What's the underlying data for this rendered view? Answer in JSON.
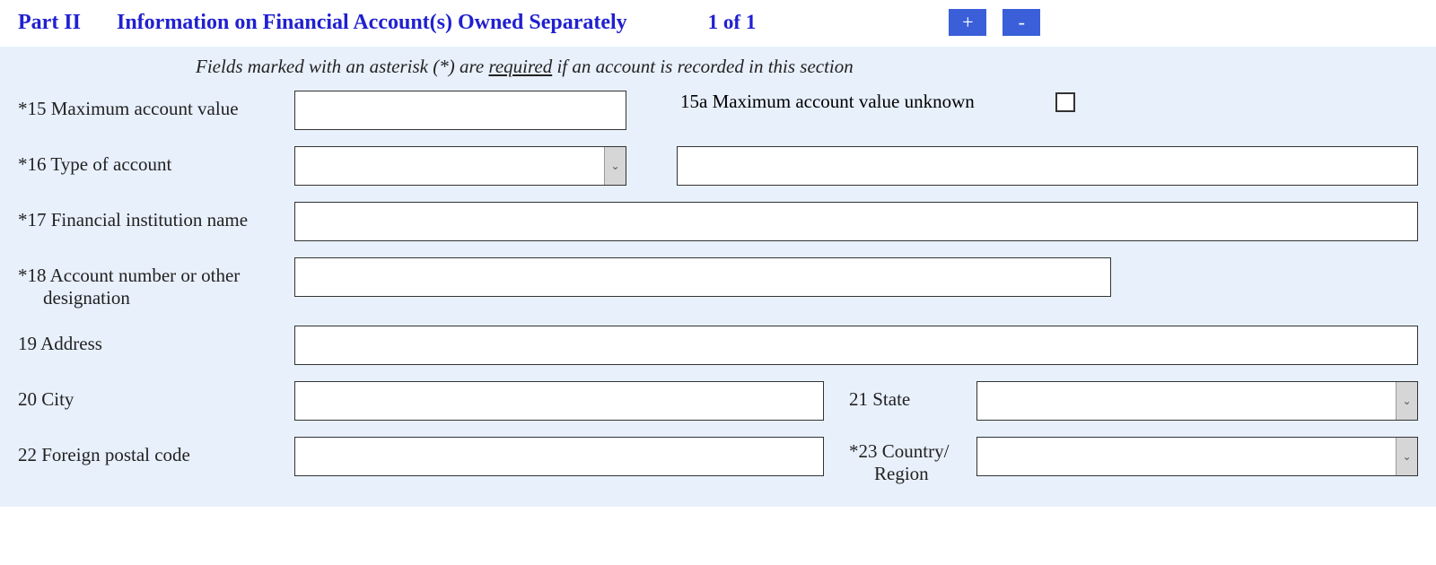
{
  "header": {
    "part": "Part II",
    "title": "Information on Financial Account(s) Owned Separately",
    "pager": "1 of 1",
    "add": "+",
    "remove": "-"
  },
  "instruction": {
    "pre": "Fields marked with an asterisk (*) are ",
    "req": "required",
    "post": " if an account is recorded in this section"
  },
  "fields": {
    "f15": "*15 Maximum account value",
    "f15a": "15a Maximum account value unknown",
    "f16": "*16 Type of account",
    "f17": "*17 Financial institution name",
    "f18a": "*18 Account number or other",
    "f18b": "designation",
    "f19": "19  Address",
    "f20": "20  City",
    "f21": "21 State",
    "f22": "22 Foreign postal code",
    "f23a": "*23 Country/",
    "f23b": "Region"
  },
  "values": {
    "v15": "",
    "v16": "",
    "v16other": "",
    "v17": "",
    "v18": "",
    "v19": "",
    "v20": "",
    "v21": "",
    "v22": "",
    "v23": ""
  }
}
